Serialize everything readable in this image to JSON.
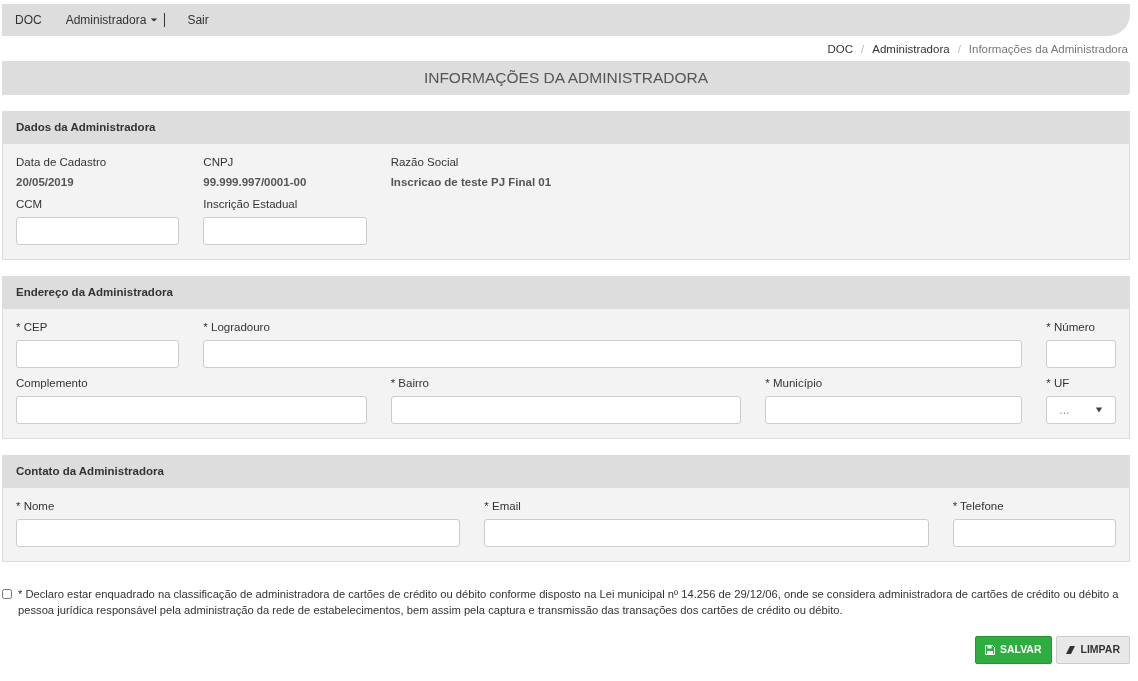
{
  "navbar": {
    "brand": "DOC",
    "menu": [
      {
        "label": "Administradora",
        "kind": "dropdown"
      },
      {
        "label": "Sair",
        "kind": "link"
      }
    ]
  },
  "breadcrumb_separator": "/",
  "breadcrumb": [
    {
      "label": "DOC",
      "selected": false
    },
    {
      "label": "Administradora",
      "selected": false
    },
    {
      "label": "Informações da Administradora",
      "selected": true
    }
  ],
  "page_title": "INFORMAÇÕES DA ADMINISTRADORA",
  "sections": [
    {
      "title": "Dados da Administradora",
      "info": [
        {
          "label": "Data de Cadastro",
          "value": "20/05/2019"
        },
        {
          "label": "CNPJ",
          "value": "99.999.997/0001-00"
        },
        {
          "label": "Razão Social",
          "value": "Inscricao de teste PJ Final 01"
        }
      ],
      "fields": [
        {
          "label": "CCM",
          "kind": "text"
        },
        {
          "label": "Inscrição Estadual",
          "kind": "text"
        }
      ]
    },
    {
      "title": "Endereço da Administradora",
      "fields": [
        {
          "label": "* CEP",
          "kind": "text"
        },
        {
          "label": "* Logradouro",
          "kind": "text"
        },
        {
          "label": "* Número",
          "kind": "text"
        },
        {
          "label": "Complemento",
          "kind": "text"
        },
        {
          "label": "* Bairro",
          "kind": "text"
        },
        {
          "label": "* Município",
          "kind": "text"
        },
        {
          "label": "* UF",
          "kind": "select",
          "placeholder": "..."
        }
      ]
    },
    {
      "title": "Contato da Administradora",
      "fields": [
        {
          "label": "* Nome",
          "kind": "text"
        },
        {
          "label": "* Email",
          "kind": "text"
        },
        {
          "label": "* Telefone",
          "kind": "text"
        }
      ]
    }
  ],
  "declaration": {
    "checked": false,
    "text": "* Declaro estar enquadrado na classificação de administradora de cartões de crédito ou débito conforme disposto na Lei municipal nº 14.256 de 29/12/06, onde se considera administradora de cartões de crédito ou débito a pessoa jurídica responsável pela administração da rede de estabelecimentos, bem assim pela captura e transmissão das transações dos cartões de crédito ou débito."
  },
  "buttons": [
    {
      "label": "SALVAR",
      "kind": "save"
    },
    {
      "label": "LIMPAR",
      "kind": "clear"
    }
  ]
}
